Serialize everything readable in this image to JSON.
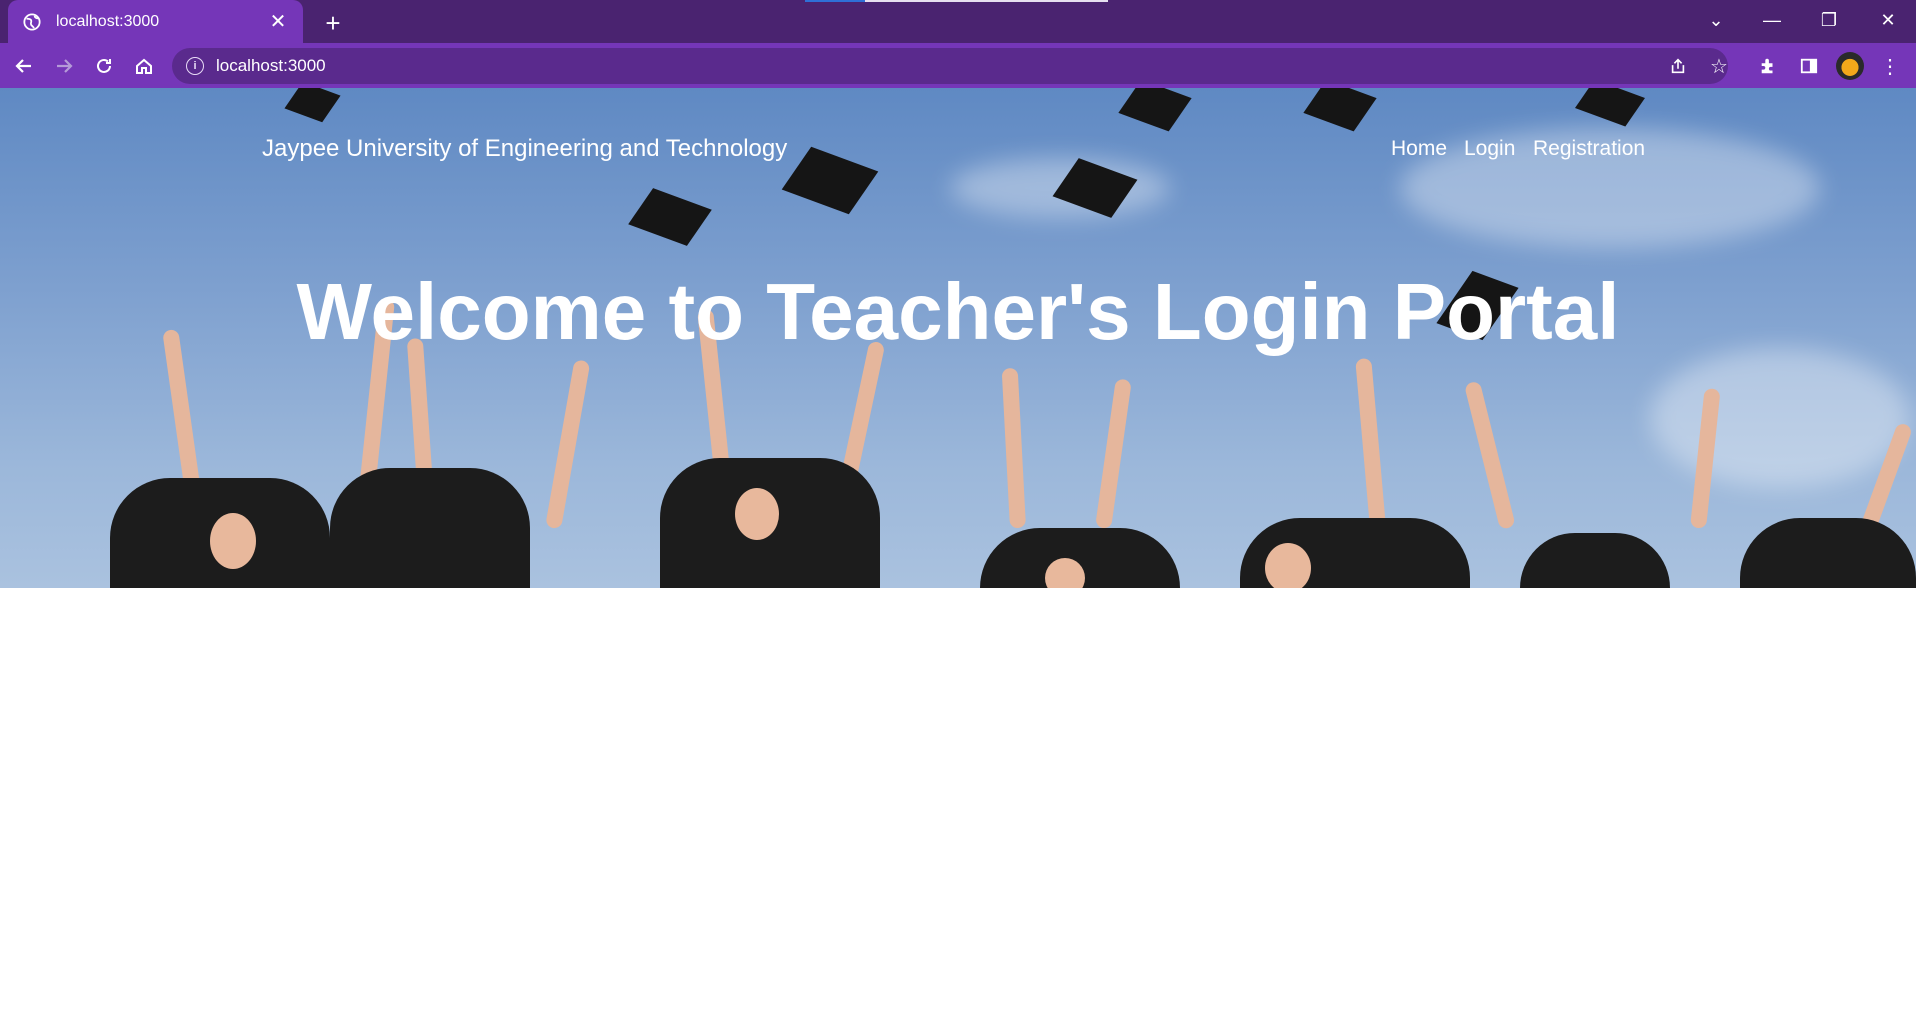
{
  "browser": {
    "tab_title": "localhost:3000",
    "url": "localhost:3000"
  },
  "header": {
    "brand": "Jaypee University of Engineering and Technology",
    "nav": [
      "Home",
      "Login",
      "Registration"
    ]
  },
  "hero": {
    "headline": "Welcome to Teacher's Login Portal"
  },
  "colors": {
    "tabstrip": "#4a2370",
    "toolbar": "#7536b8",
    "omnibox": "#5a2a8d"
  }
}
